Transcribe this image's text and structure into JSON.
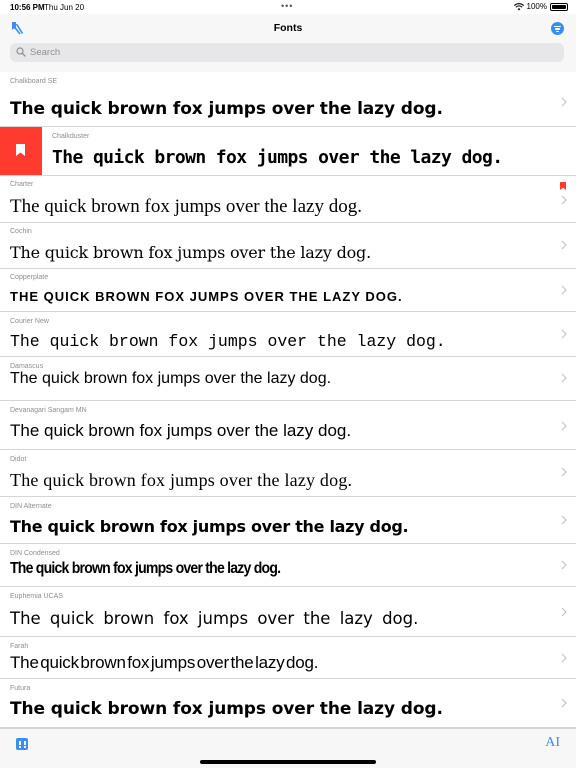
{
  "status_bar": {
    "time": "10:56 PM",
    "date": "Thu Jun 20",
    "dots": "•••",
    "battery": "100%",
    "wifi_icon": "wifi-icon",
    "battery_icon": "battery-icon"
  },
  "nav": {
    "title": "Fonts",
    "left_icon": "bookmarks-list-icon",
    "right_icon": "filter-icon",
    "search_placeholder": "Search"
  },
  "colors": {
    "accent": "#3b8df0",
    "bookmark": "#ff3b30",
    "separator": "#d6d6d8",
    "secondary_text": "#8e8e93"
  },
  "fonts": [
    {
      "name": "Chalkboard SE",
      "sample": "The quick brown fox jumps over the lazy dog."
    },
    {
      "name": "Chalkduster",
      "sample": "The quick brown fox jumps over the lazy dog.",
      "selected": true
    },
    {
      "name": "Charter",
      "sample": "The quick brown fox jumps over the lazy dog.",
      "bookmarked": true
    },
    {
      "name": "Cochin",
      "sample": "The quick brown fox jumps over the lazy dog."
    },
    {
      "name": "Copperplate",
      "sample": "The quick brown fox jumps over the lazy dog."
    },
    {
      "name": "Courier New",
      "sample": "The quick brown fox jumps over the lazy dog."
    },
    {
      "name": "Damascus",
      "sample": "The quick brown fox jumps over the lazy dog."
    },
    {
      "name": "Devanagari Sangam MN",
      "sample": "The quick brown fox jumps over the lazy dog."
    },
    {
      "name": "Didot",
      "sample": "The quick brown fox jumps over the lazy dog."
    },
    {
      "name": "DIN Alternate",
      "sample": "The quick brown fox jumps over the lazy dog."
    },
    {
      "name": "DIN Condensed",
      "sample": "The quick brown fox jumps over the lazy dog."
    },
    {
      "name": "Euphemia UCAS",
      "sample": "The quick brown fox jumps over the lazy dog."
    },
    {
      "name": "Farah",
      "sample": "The quick brown fox jumps over the lazy dog."
    },
    {
      "name": "Futura",
      "sample": "The quick brown fox jumps over the lazy dog."
    }
  ],
  "toolbar": {
    "left_icon": "grid-icon",
    "right_icon": "text-size-icon",
    "right_label": "AI"
  }
}
